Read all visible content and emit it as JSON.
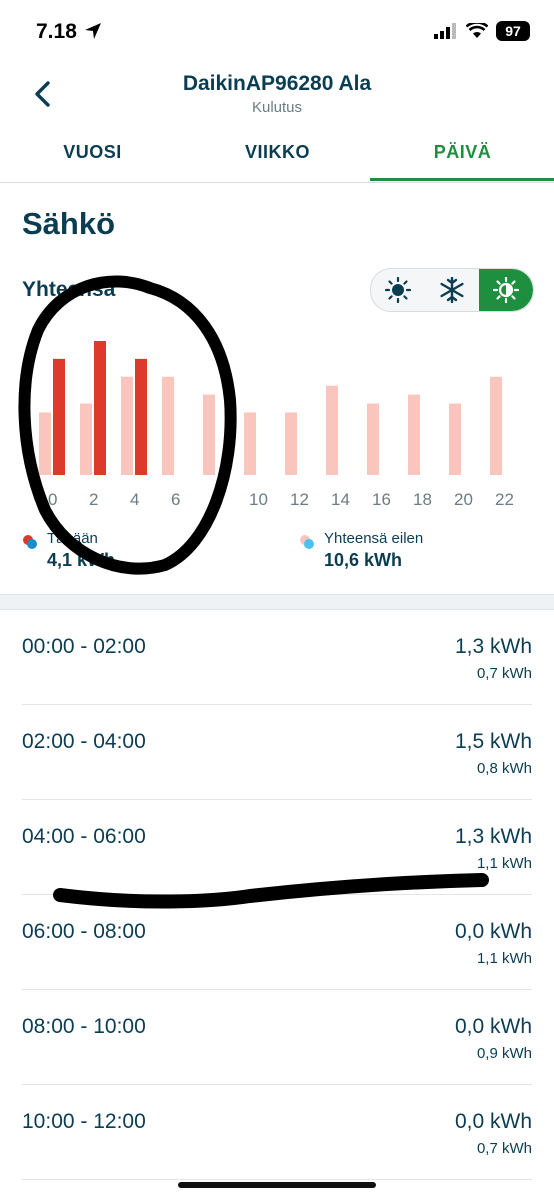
{
  "status": {
    "time": "7.18",
    "battery": "97"
  },
  "header": {
    "title": "DaikinAP96280 Ala",
    "subtitle": "Kulutus"
  },
  "tabs": [
    {
      "label": "VUOSI",
      "active": false
    },
    {
      "label": "VIIKKO",
      "active": false
    },
    {
      "label": "PÄIVÄ",
      "active": true
    }
  ],
  "section_title": "Sähkö",
  "total_label": "Yhteensä",
  "mode_toggle": {
    "options": [
      "sun-icon",
      "snowflake-icon",
      "auto-mode-icon"
    ],
    "active": "auto-mode-icon"
  },
  "chart_data": {
    "type": "bar",
    "x": [
      0,
      2,
      4,
      6,
      8,
      10,
      12,
      14,
      16,
      18,
      20,
      22
    ],
    "tick_labels": [
      "0",
      "2",
      "4",
      "6",
      "8",
      "10",
      "12",
      "14",
      "16",
      "18",
      "20",
      "22"
    ],
    "series": [
      {
        "name": "Tänään",
        "color": "#dd3a2c",
        "values": [
          1.3,
          1.5,
          1.3,
          0,
          0,
          0,
          0,
          0,
          0,
          0,
          0,
          0
        ]
      },
      {
        "name": "Yhteensä eilen",
        "color": "#f9c5bd",
        "values": [
          0.7,
          0.8,
          1.1,
          1.1,
          0.9,
          0.7,
          0.7,
          1.0,
          0.8,
          0.9,
          0.8,
          1.1
        ]
      }
    ],
    "ylim": [
      0,
      1.5
    ]
  },
  "legend": {
    "today": {
      "label": "Tänään",
      "value": "4,1 kWh"
    },
    "yesterday": {
      "label": "Yhteensä eilen",
      "value": "10,6 kWh"
    }
  },
  "rows": [
    {
      "time": "00:00 - 02:00",
      "value": "1,3 kWh",
      "sub": "0,7 kWh"
    },
    {
      "time": "02:00 - 04:00",
      "value": "1,5 kWh",
      "sub": "0,8 kWh"
    },
    {
      "time": "04:00 - 06:00",
      "value": "1,3 kWh",
      "sub": "1,1 kWh"
    },
    {
      "time": "06:00 - 08:00",
      "value": "0,0 kWh",
      "sub": "1,1 kWh"
    },
    {
      "time": "08:00 - 10:00",
      "value": "0,0 kWh",
      "sub": "0,9 kWh"
    },
    {
      "time": "10:00 - 12:00",
      "value": "0,0 kWh",
      "sub": "0,7 kWh"
    }
  ],
  "colors": {
    "accent": "#1e8f3f",
    "text": "#0b3d52",
    "today": "#dd3a2c",
    "yesterday": "#f9c5bd",
    "yesterday_dot": "#4cc3ee"
  }
}
